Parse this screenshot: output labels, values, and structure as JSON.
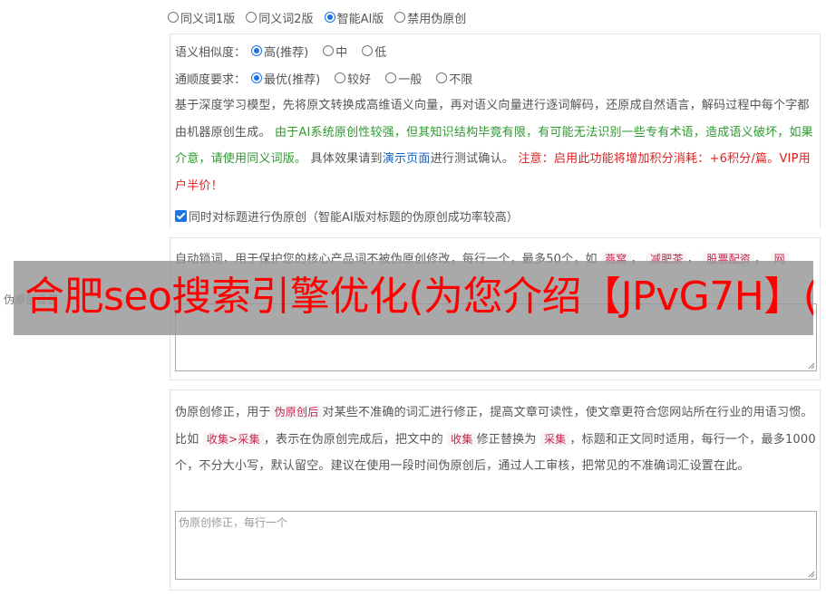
{
  "mode_options": [
    {
      "label": "同义词1版",
      "checked": false
    },
    {
      "label": "同义词2版",
      "checked": false
    },
    {
      "label": "智能AI版",
      "checked": true
    },
    {
      "label": "禁用伪原创",
      "checked": false
    }
  ],
  "similarity": {
    "label": "语义相似度：",
    "options": [
      {
        "label": "高(推荐)",
        "checked": true
      },
      {
        "label": "中",
        "checked": false
      },
      {
        "label": "低",
        "checked": false
      }
    ]
  },
  "fluency": {
    "label": "通顺度要求：",
    "options": [
      {
        "label": "最优(推荐)",
        "checked": true
      },
      {
        "label": "较好",
        "checked": false
      },
      {
        "label": "一般",
        "checked": false
      },
      {
        "label": "不限",
        "checked": false
      }
    ]
  },
  "description": {
    "part1": "基于深度学习模型，先将原文转换成高维语义向量，再对语义向量进行逐词解码，还原成自然语言，解码过程中每个字都由机器原创生成。",
    "part2_green": "由于AI系统原创性较强，但其知识结构毕竟有限，有可能无法识别一些专有术语，造成语义破坏，如果介意，请使用同义词版。",
    "part3": "具体效果请到",
    "demo_link": "演示页面",
    "part4": "进行测试确认。",
    "part5_red": "注意：启用此功能将增加积分消耗：+6积分/篇。VIP用户半价！"
  },
  "title_checkbox": {
    "label": "同时对标题进行伪原创（智能AI版对标题的伪原创成功率较高）",
    "checked": true
  },
  "lock_words": {
    "intro": "自动锁词，用于保护您的核心产品词不被伪原创修改，每行一个，最多50个，如",
    "tags": [
      "燕窝",
      "减肥茶",
      "股票配资",
      "网"
    ],
    "hidden_text": "…相…",
    "side_label": "伪原创设置"
  },
  "correction": {
    "text1": "伪原创修正，用于",
    "tag1": "伪原创后",
    "text2": "对某些不准确的词汇进行修正，提高文章可读性，使文章更符合您网站所在行业的用语习惯。比如",
    "tag2": "收集>采集",
    "text3": "，表示在伪原创完成后，把文中的",
    "tag3": "收集",
    "text4": "修正替换为",
    "tag4": "采集",
    "text5": "，标题和正文同时适用，每行一个，最多1000个，不分大小写，默认留空。建议在使用一段时间伪原创后，通过人工审核，把常见的不准确词汇设置在此。",
    "placeholder": "伪原创修正，每行一个"
  },
  "overlay": {
    "text": "合肥seo搜索引擎优化(为您介绍【JPvG7H】("
  },
  "colors": {
    "accent": "#1a73e8",
    "green": "#2e9a2e",
    "red": "#e02020",
    "link": "#1565c0",
    "overlay_text": "#ff0000"
  }
}
